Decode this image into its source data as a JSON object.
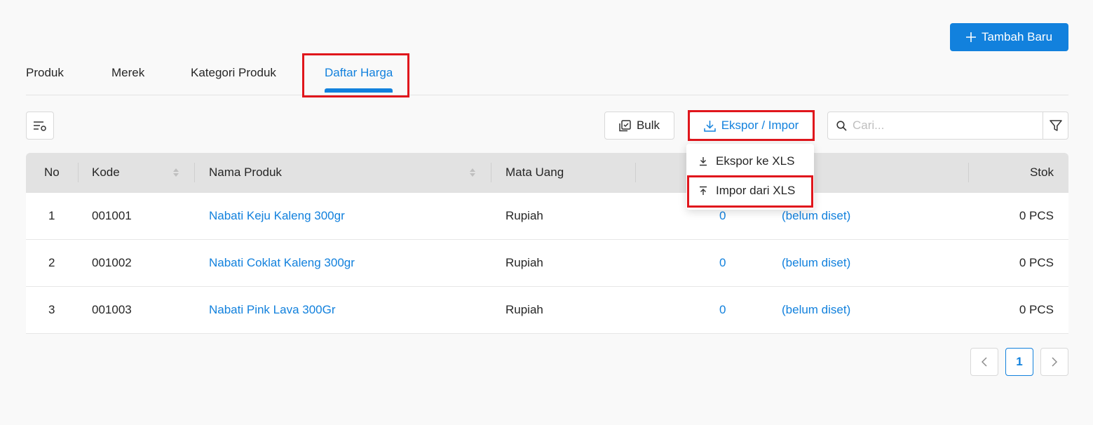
{
  "header": {
    "add_button_label": "Tambah Baru"
  },
  "tabs": [
    {
      "label": "Produk",
      "active": false
    },
    {
      "label": "Merek",
      "active": false
    },
    {
      "label": "Kategori Produk",
      "active": false
    },
    {
      "label": "Daftar Harga",
      "active": true
    }
  ],
  "toolbar": {
    "bulk_label": "Bulk",
    "export_import_label": "Ekspor / Impor",
    "search_placeholder": "Cari..."
  },
  "dropdown": {
    "items": [
      {
        "label": "Ekspor ke XLS",
        "icon": "download-icon"
      },
      {
        "label": "Impor dari XLS",
        "icon": "upload-icon"
      }
    ]
  },
  "table": {
    "headers": {
      "no": "No",
      "kode": "Kode",
      "nama": "Nama Produk",
      "mata_uang": "Mata Uang",
      "stok": "Stok"
    },
    "rows": [
      {
        "no": "1",
        "kode": "001001",
        "nama": "Nabati Keju Kaleng 300gr",
        "mata_uang": "Rupiah",
        "harga": "0",
        "status": "(belum diset)",
        "stok": "0 PCS"
      },
      {
        "no": "2",
        "kode": "001002",
        "nama": "Nabati Coklat Kaleng 300gr",
        "mata_uang": "Rupiah",
        "harga": "0",
        "status": "(belum diset)",
        "stok": "0 PCS"
      },
      {
        "no": "3",
        "kode": "001003",
        "nama": "Nabati Pink Lava 300Gr",
        "mata_uang": "Rupiah",
        "harga": "0",
        "status": "(belum diset)",
        "stok": "0 PCS"
      }
    ]
  },
  "pagination": {
    "current": "1"
  },
  "colors": {
    "accent": "#1281dd",
    "highlight": "#e0161c"
  }
}
